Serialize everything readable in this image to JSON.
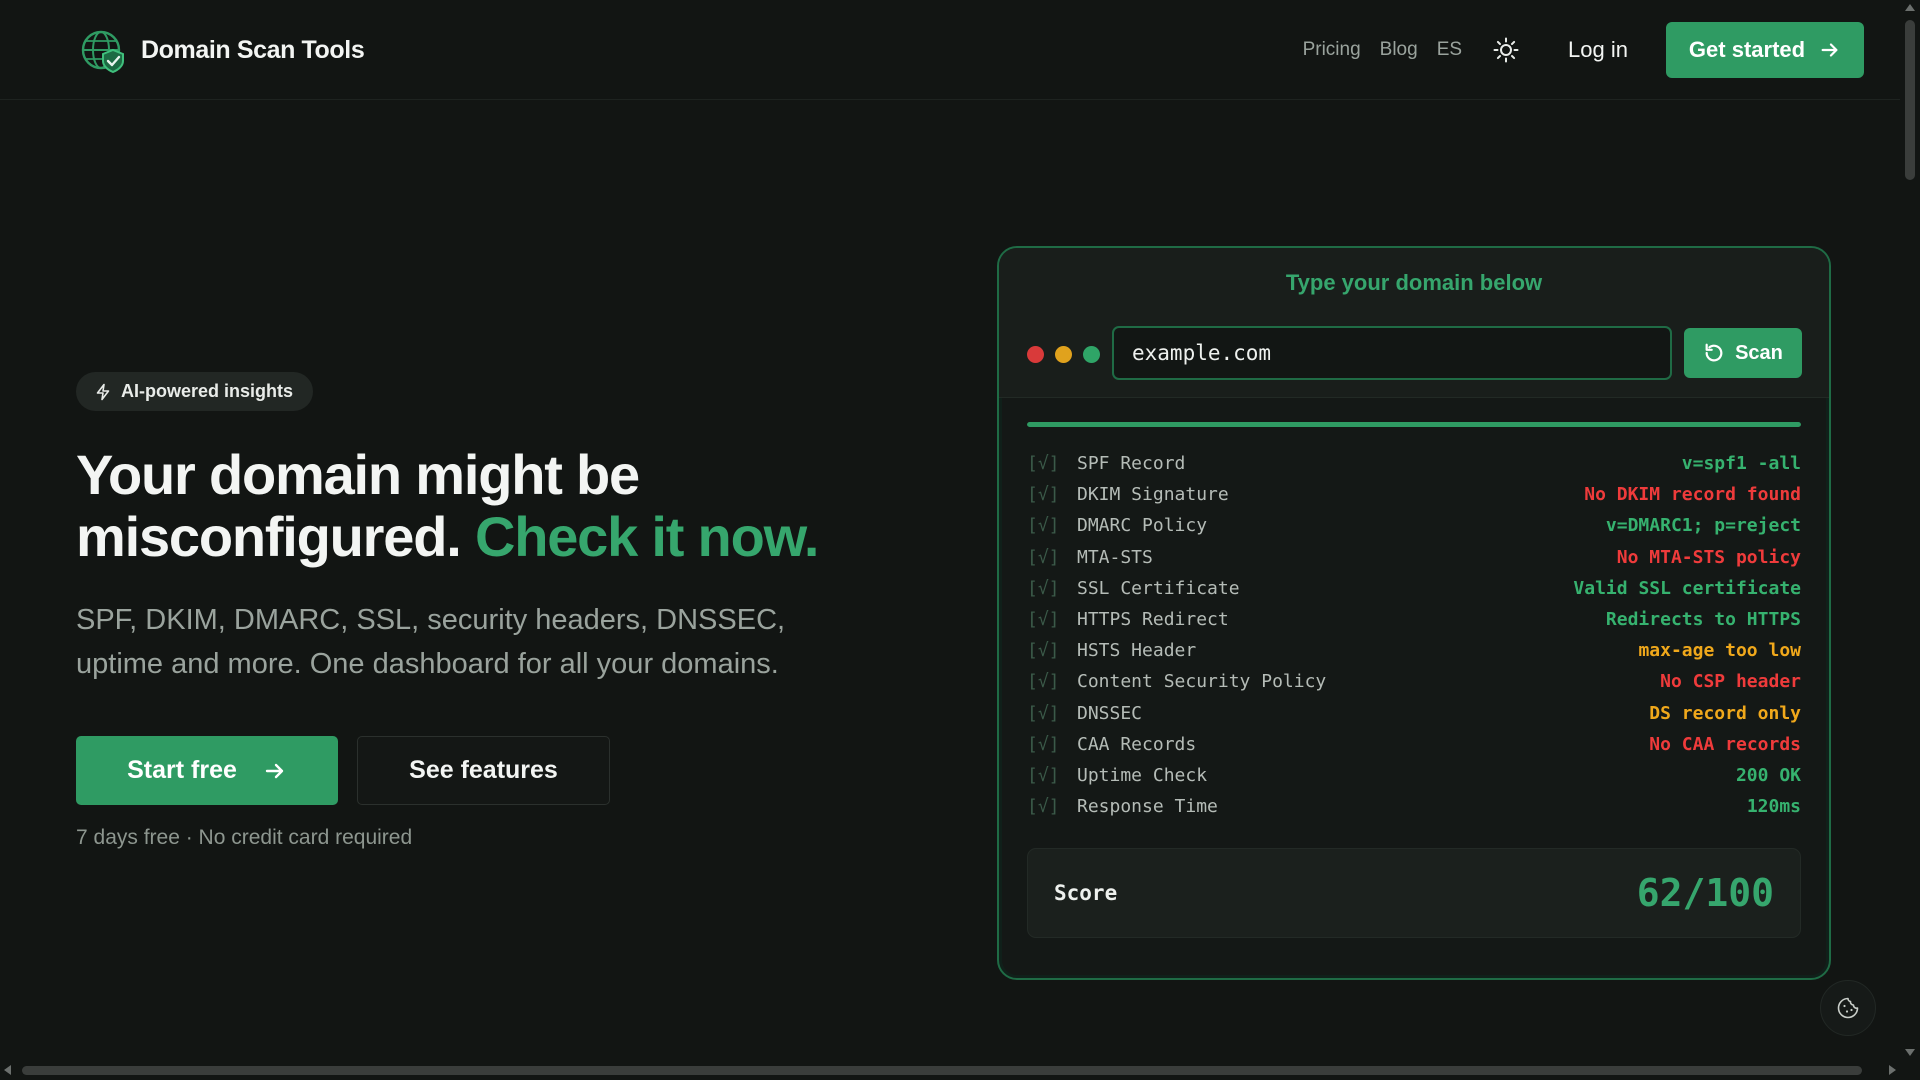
{
  "header": {
    "brand_name": "Domain Scan Tools",
    "nav": {
      "pricing": "Pricing",
      "blog": "Blog",
      "lang": "ES"
    },
    "login": "Log in",
    "get_started": "Get started"
  },
  "hero": {
    "badge": "AI-powered insights",
    "headline_part1": "Your domain might be misconfigured.",
    "headline_accent": "Check it now.",
    "subtitle": "SPF, DKIM, DMARC, SSL, security headers, DNSSEC, uptime and more. One dashboard for all your domains.",
    "start_free": "Start free",
    "see_features": "See features",
    "fine_print": "7 days free · No credit card required"
  },
  "scanner": {
    "heading": "Type your domain below",
    "domain_value": "example.com",
    "scan_label": "Scan",
    "progress": 1.0,
    "check_mark": "[√]",
    "checks": [
      {
        "label": "SPF Record",
        "result": "v=spf1 -all",
        "status": "ok"
      },
      {
        "label": "DKIM Signature",
        "result": "No DKIM record found",
        "status": "fail"
      },
      {
        "label": "DMARC Policy",
        "result": "v=DMARC1; p=reject",
        "status": "ok"
      },
      {
        "label": "MTA-STS",
        "result": "No MTA-STS policy",
        "status": "fail"
      },
      {
        "label": "SSL Certificate",
        "result": "Valid SSL certificate",
        "status": "ok"
      },
      {
        "label": "HTTPS Redirect",
        "result": "Redirects to HTTPS",
        "status": "ok"
      },
      {
        "label": "HSTS Header",
        "result": "max-age too low",
        "status": "warn"
      },
      {
        "label": "Content Security Policy",
        "result": "No CSP header",
        "status": "fail"
      },
      {
        "label": "DNSSEC",
        "result": "DS record only",
        "status": "warn"
      },
      {
        "label": "CAA Records",
        "result": "No CAA records",
        "status": "fail"
      },
      {
        "label": "Uptime Check",
        "result": "200 OK",
        "status": "ok"
      },
      {
        "label": "Response Time",
        "result": "120ms",
        "status": "ok"
      }
    ],
    "score_label": "Score",
    "score_value": "62/100"
  },
  "colors": {
    "accent": "#2f9b63",
    "ok": "#36b26f",
    "fail": "#ef3b3b",
    "warn": "#f0a81b",
    "dot_red": "#d93a3a",
    "dot_yellow": "#e0a21d",
    "dot_green": "#2fa567"
  },
  "icons": {
    "brand": "globe-shield-icon",
    "theme": "sun-icon",
    "arrow": "arrow-right-icon",
    "badge": "lightning-icon",
    "scan": "refresh-icon",
    "cookie": "cookie-icon"
  }
}
